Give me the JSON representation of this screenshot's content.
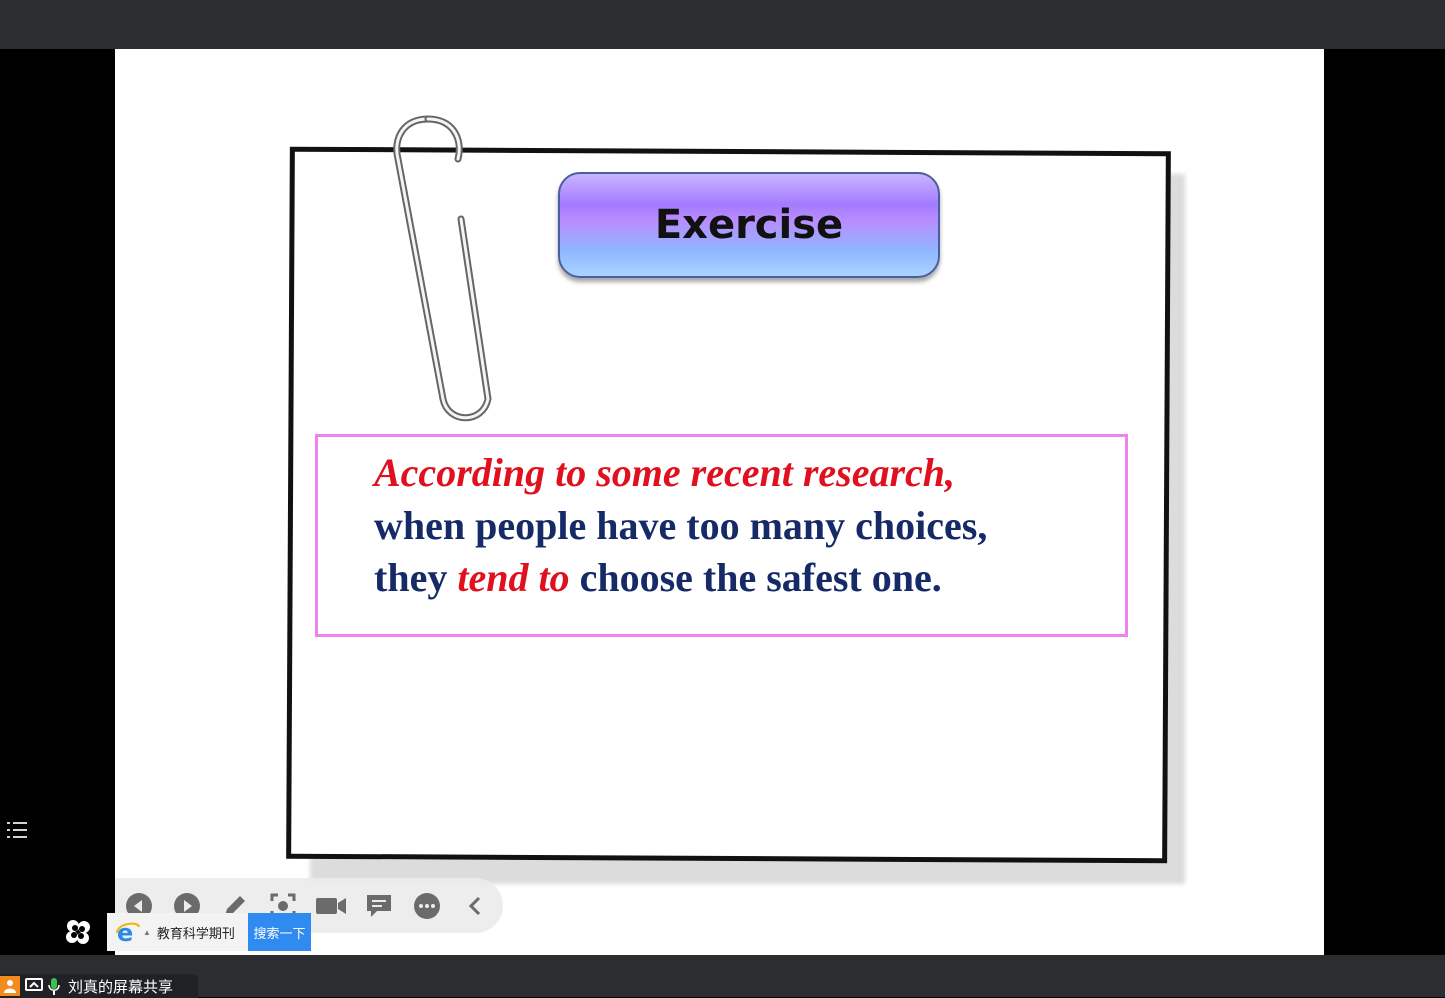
{
  "slide": {
    "heading_button": "Exercise",
    "sentence": {
      "line1": "According to some recent research,",
      "line2": "when people have too many choices,",
      "line3_start": "they ",
      "line3_highlight": "tend to",
      "line3_end": " choose the safest one."
    }
  },
  "toolbar": {
    "items": [
      "prev-icon",
      "next-icon",
      "pen-icon",
      "screenshot-icon",
      "camera-icon",
      "chat-icon",
      "more-icon",
      "collapse-icon"
    ]
  },
  "browser": {
    "link_text": "教育科学期刊",
    "search_button": "搜索一下"
  },
  "share": {
    "label": "刘真的屏幕共享"
  },
  "colors": {
    "title_text": "#152a66",
    "emphasis": "#e0101e",
    "textbox_border": "#ee82ee"
  }
}
